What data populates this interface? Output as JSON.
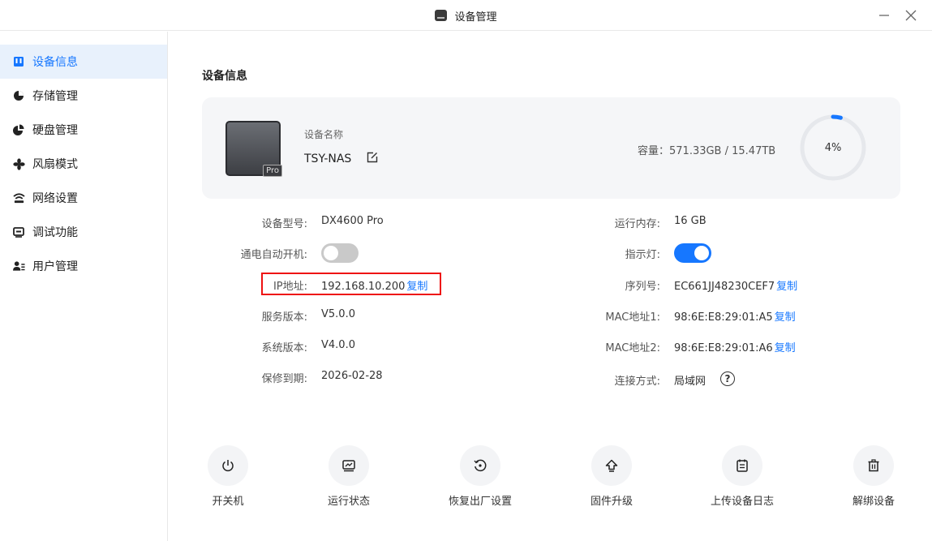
{
  "window": {
    "title": "设备管理"
  },
  "sidebar": {
    "items": [
      {
        "label": "设备信息",
        "icon": "device-info-icon"
      },
      {
        "label": "存储管理",
        "icon": "storage-pie-icon"
      },
      {
        "label": "硬盘管理",
        "icon": "disk-pie-icon"
      },
      {
        "label": "风扇模式",
        "icon": "fan-icon"
      },
      {
        "label": "网络设置",
        "icon": "wifi-icon"
      },
      {
        "label": "调试功能",
        "icon": "debug-icon"
      },
      {
        "label": "用户管理",
        "icon": "users-icon"
      }
    ]
  },
  "main": {
    "section_title": "设备信息",
    "device": {
      "name_label": "设备名称",
      "name": "TSY-NAS",
      "badge": "Pro",
      "capacity": "容量：571.33GB / 15.47TB",
      "usage_percent": 4,
      "usage_text": "4%"
    },
    "left": {
      "model_label": "设备型号:",
      "model_value": "DX4600 Pro",
      "autopower_label": "通电自动开机:",
      "autopower_on": false,
      "ip_label": "IP地址:",
      "ip_value": "192.168.10.200",
      "service_label": "服务版本:",
      "service_value": "V5.0.0",
      "system_label": "系统版本:",
      "system_value": "V4.0.0",
      "warranty_label": "保修到期:",
      "warranty_value": "2026-02-28"
    },
    "right": {
      "memory_label": "运行内存:",
      "memory_value": "16 GB",
      "indicator_label": "指示灯:",
      "indicator_on": true,
      "serial_label": "序列号:",
      "serial_value": "EC661JJ48230CEF7",
      "mac1_label": "MAC地址1:",
      "mac1_value": "98:6E:E8:29:01:A5",
      "mac2_label": "MAC地址2:",
      "mac2_value": "98:6E:E8:29:01:A6",
      "conn_label": "连接方式:",
      "conn_value": "局域网"
    },
    "copy_label": "复制",
    "actions": [
      {
        "label": "开关机",
        "icon": "power-icon"
      },
      {
        "label": "运行状态",
        "icon": "monitor-icon"
      },
      {
        "label": "恢复出厂设置",
        "icon": "restore-icon"
      },
      {
        "label": "固件升级",
        "icon": "upgrade-icon"
      },
      {
        "label": "上传设备日志",
        "icon": "log-icon"
      },
      {
        "label": "解绑设备",
        "icon": "trash-icon"
      }
    ]
  },
  "colors": {
    "accent": "#1677ff",
    "highlight_box": "#ee1111",
    "toggle_off": "#c9c9c9"
  }
}
